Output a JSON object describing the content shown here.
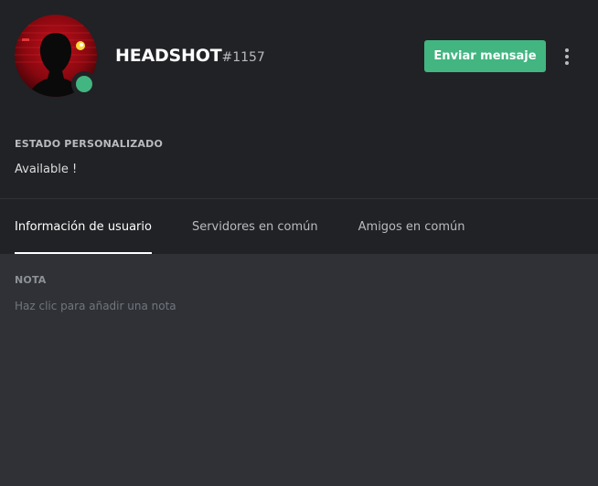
{
  "profile": {
    "username": "HEADSHOT",
    "discriminator": "#1157",
    "status": "online",
    "send_message_label": "Enviar mensaje",
    "more_icon": "more-vertical-icon"
  },
  "custom_status": {
    "title": "ESTADO PERSONALIZADO",
    "text": "Available !"
  },
  "tabs": [
    {
      "label": "Información de usuario",
      "active": true
    },
    {
      "label": "Servidores en común",
      "active": false
    },
    {
      "label": "Amigos en común",
      "active": false
    }
  ],
  "note": {
    "title": "NOTA",
    "placeholder": "Haz clic para añadir una nota"
  },
  "colors": {
    "header_bg": "#202225",
    "body_bg": "#2f3136",
    "accent_green": "#43b581",
    "status_online": "#43b581"
  }
}
